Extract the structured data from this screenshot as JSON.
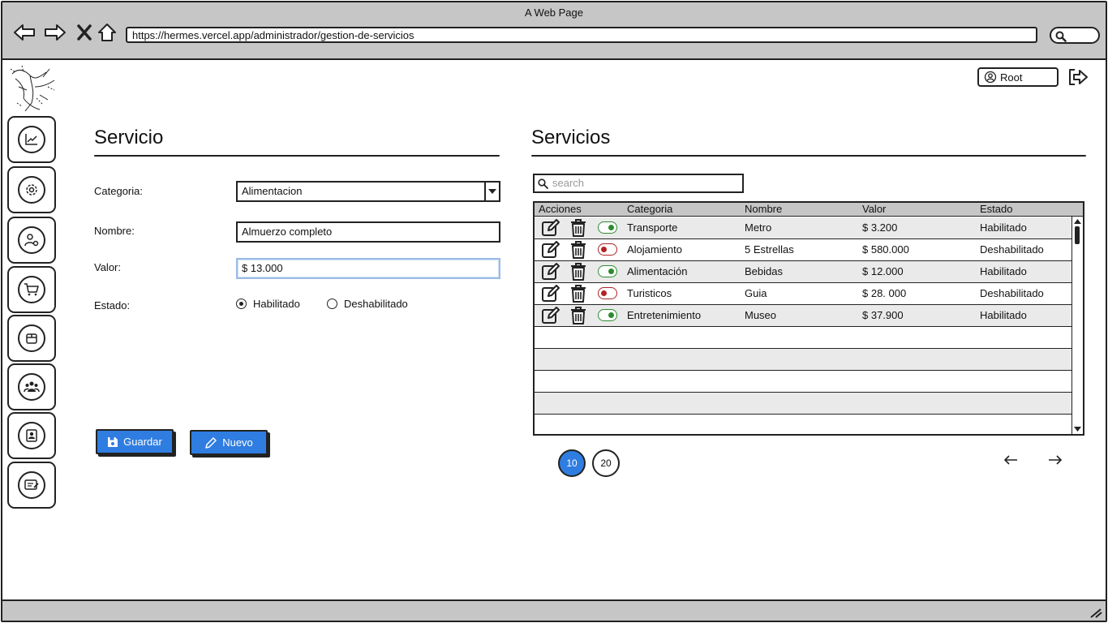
{
  "window": {
    "title": "A Web Page",
    "url": "https://hermes.vercel.app/administrador/gestion-de-servicios"
  },
  "header": {
    "user_label": "Root"
  },
  "sidebar": {
    "items": [
      "chart-icon",
      "settings-icon",
      "user-settings-icon",
      "cart-icon",
      "package-icon",
      "users-icon",
      "contact-icon",
      "id-card-icon"
    ]
  },
  "form": {
    "title": "Servicio",
    "categoria_label": "Categoria:",
    "categoria_value": "Alimentacion",
    "nombre_label": "Nombre:",
    "nombre_value": "Almuerzo completo",
    "valor_label": "Valor:",
    "valor_value": "$ 13.000",
    "estado_label": "Estado:",
    "estado_options": [
      "Habilitado",
      "Deshabilitado"
    ],
    "estado_selected": "Habilitado",
    "save_label": "Guardar",
    "new_label": "Nuevo"
  },
  "list": {
    "title": "Servicios",
    "search_placeholder": "search",
    "columns": [
      "Acciones",
      "Categoria",
      "Nombre",
      "Valor",
      "Estado"
    ],
    "rows": [
      {
        "categoria": "Transporte",
        "nombre": "Metro",
        "valor": "$ 3.200",
        "estado": "Habilitado",
        "enabled": true
      },
      {
        "categoria": "Alojamiento",
        "nombre": "5 Estrellas",
        "valor": "$ 580.000",
        "estado": "Deshabilitado",
        "enabled": false
      },
      {
        "categoria": "Alimentación",
        "nombre": "Bebidas",
        "valor": "$ 12.000",
        "estado": "Habilitado",
        "enabled": true
      },
      {
        "categoria": "Turisticos",
        "nombre": "Guia",
        "valor": "$ 28. 000",
        "estado": "Deshabilitado",
        "enabled": false
      },
      {
        "categoria": "Entretenimiento",
        "nombre": "Museo",
        "valor": "$ 37.900",
        "estado": "Habilitado",
        "enabled": true
      }
    ],
    "page_sizes": [
      "10",
      "20"
    ],
    "active_page_size": "10"
  },
  "colors": {
    "accent": "#2f7de1",
    "enabled": "#2e8b2e",
    "disabled": "#b22222",
    "chrome": "#c6c6c6"
  }
}
